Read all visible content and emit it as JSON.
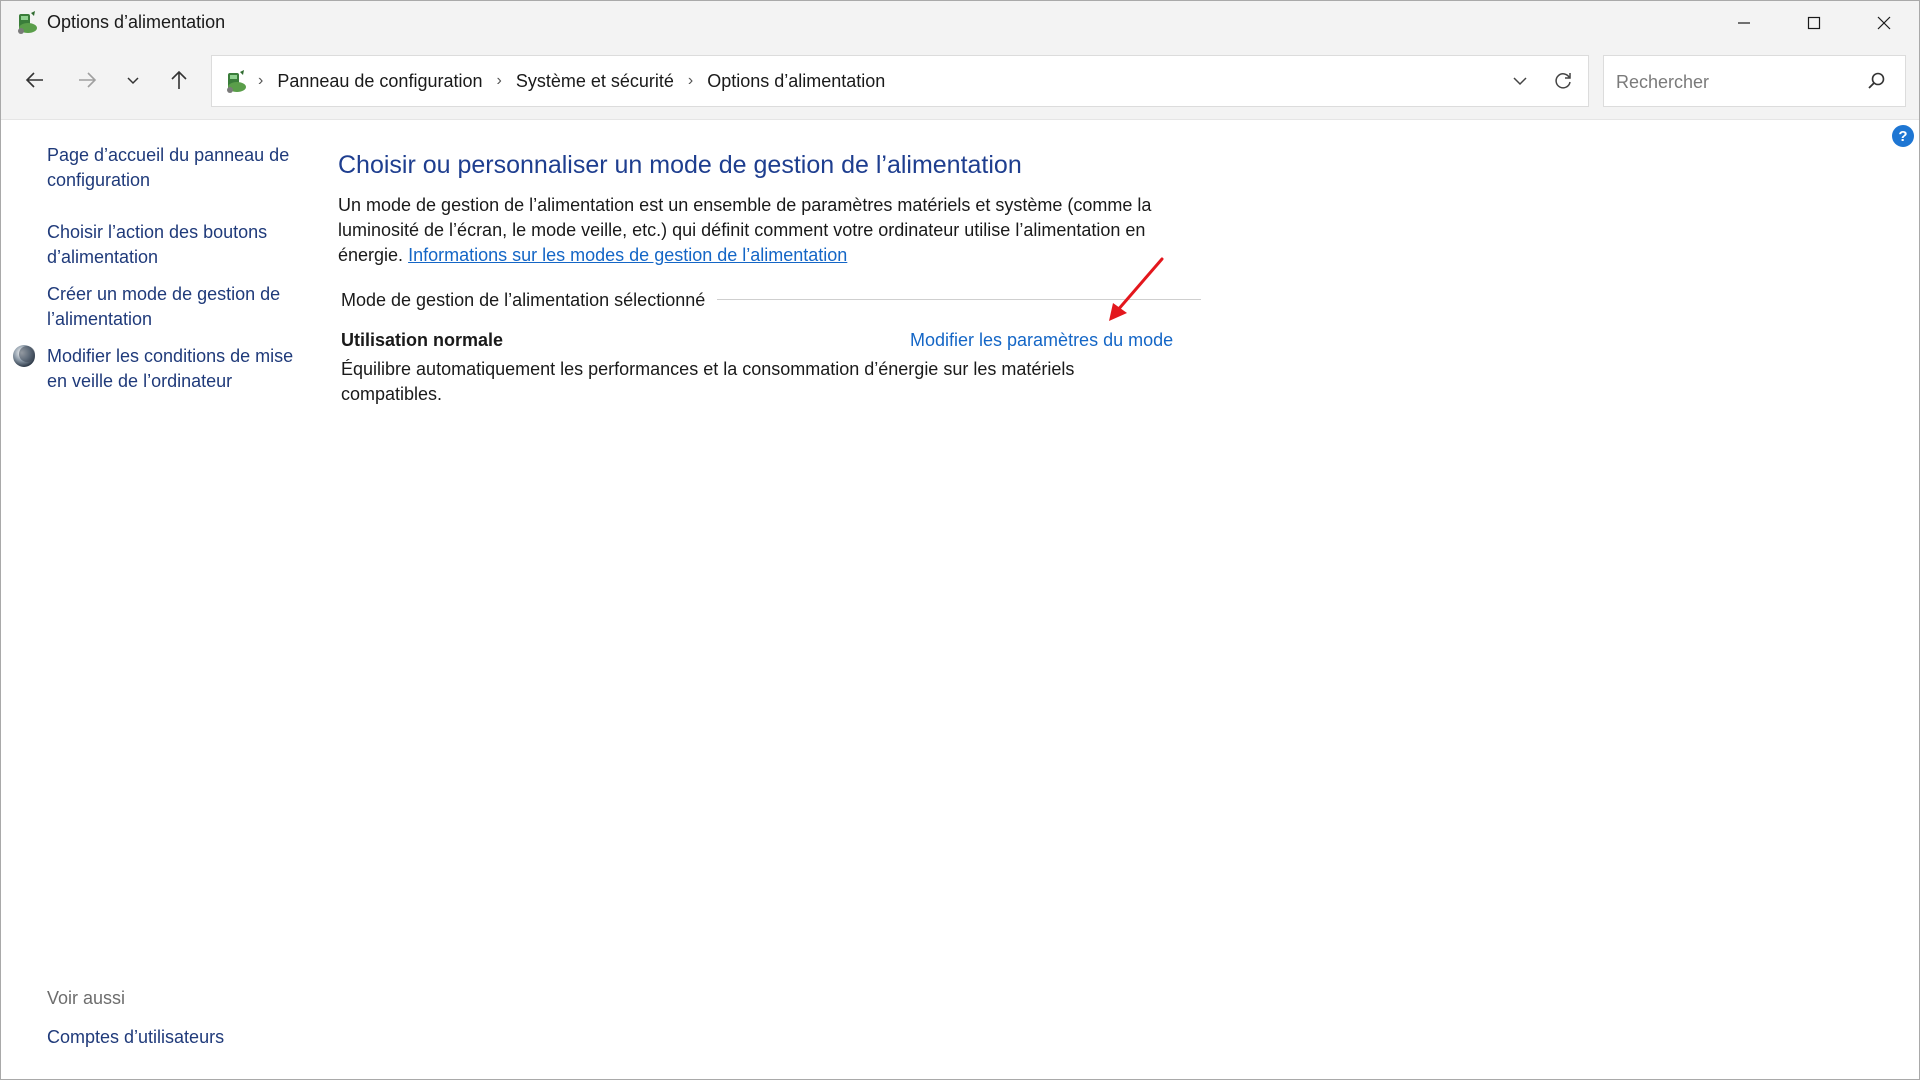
{
  "window": {
    "title": "Options d’alimentation"
  },
  "breadcrumb": [
    "Panneau de configuration",
    "Système et sécurité",
    "Options d’alimentation"
  ],
  "search": {
    "placeholder": "Rechercher"
  },
  "help": {
    "label": "?"
  },
  "sidebar": {
    "links": [
      "Page d’accueil du panneau de configuration",
      "Choisir l’action des boutons d’alimentation",
      "Créer un mode de gestion de l’alimentation",
      "Modifier les conditions de mise en veille de l’ordinateur"
    ],
    "see_also_title": "Voir aussi",
    "see_also_links": [
      "Comptes d’utilisateurs"
    ]
  },
  "main": {
    "title": "Choisir ou personnaliser un mode de gestion de l’alimentation",
    "intro_text": "Un mode de gestion de l’alimentation est un ensemble de paramètres matériels et système (comme la luminosité de l’écran, le mode veille, etc.) qui définit comment votre ordinateur utilise l’alimentation en énergie.",
    "intro_link": "Informations sur les modes de gestion de l’alimentation",
    "section_label": "Mode de gestion de l’alimentation sélectionné",
    "plan": {
      "name": "Utilisation normale",
      "change_link": "Modifier les paramètres du mode",
      "description": "Équilibre automatiquement les performances et la consommation d’énergie sur les matériels compatibles."
    }
  },
  "colors": {
    "link": "#1466c6",
    "sidebar_link": "#1f3a7a",
    "title": "#1e3e8f",
    "annotation_arrow": "#e3171d",
    "help": "#1e76d3"
  }
}
